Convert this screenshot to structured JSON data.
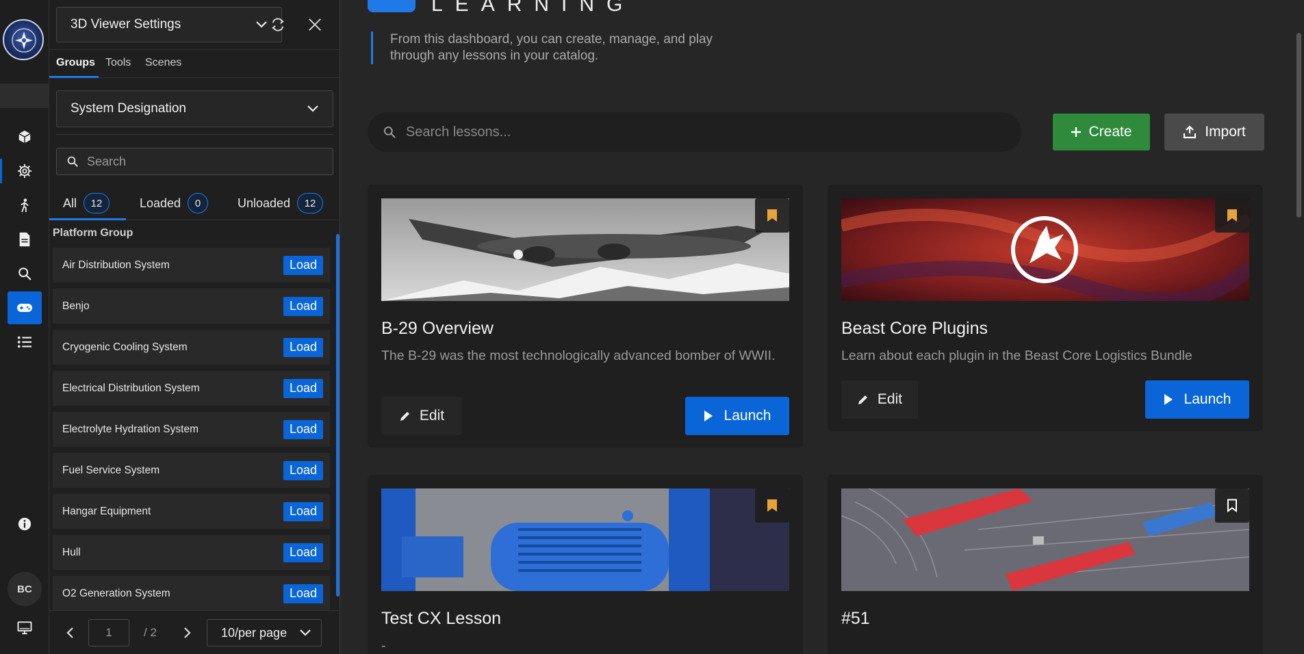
{
  "sidebar_rail": {
    "avatar_initials": "BC",
    "icons": [
      "cube-icon",
      "gear-icon",
      "person-icon",
      "document-icon",
      "search-icon",
      "gamepad-icon",
      "list-icon",
      "info-icon",
      "monitor-icon"
    ]
  },
  "panel": {
    "viewer_select": "3D Viewer Settings",
    "tabs": [
      "Groups",
      "Tools",
      "Scenes"
    ],
    "group_select": "System Designation",
    "search_placeholder": "Search",
    "filters": [
      {
        "label": "All",
        "count": "12"
      },
      {
        "label": "Loaded",
        "count": "0"
      },
      {
        "label": "Unloaded",
        "count": "12"
      }
    ],
    "group_title": "Platform Group",
    "load_label": "Load",
    "systems": [
      "Air Distribution System",
      "Benjo",
      "Cryogenic Cooling System",
      "Electrical Distribution System",
      "Electrolyte Hydration System",
      "Fuel Service System",
      "Hangar Equipment",
      "Hull",
      "O2 Generation System"
    ],
    "pager": {
      "page": "1",
      "total": "/ 2",
      "per_page": "10/per page"
    }
  },
  "main": {
    "brand": "LEARNING",
    "intro": "From this dashboard, you can create, manage, and play through any lessons in your catalog.",
    "search_placeholder": "Search lessons...",
    "create_label": "Create",
    "import_label": "Import",
    "edit_label": "Edit",
    "launch_label": "Launch",
    "cards": [
      {
        "title": "B-29 Overview",
        "desc": "The B-29 was the most technologically advanced bomber of WWII.",
        "bookmarked": true
      },
      {
        "title": "Beast Core Plugins",
        "desc": "Learn about each plugin in the Beast Core Logistics Bundle",
        "bookmarked": true
      },
      {
        "title": "Test CX Lesson",
        "desc": "-",
        "bookmarked": true
      },
      {
        "title": "#51",
        "desc": "",
        "bookmarked": false
      }
    ]
  },
  "colors": {
    "accent": "#0a66d8",
    "create": "#2f8a3c",
    "bookmark": "#e8a33a"
  }
}
